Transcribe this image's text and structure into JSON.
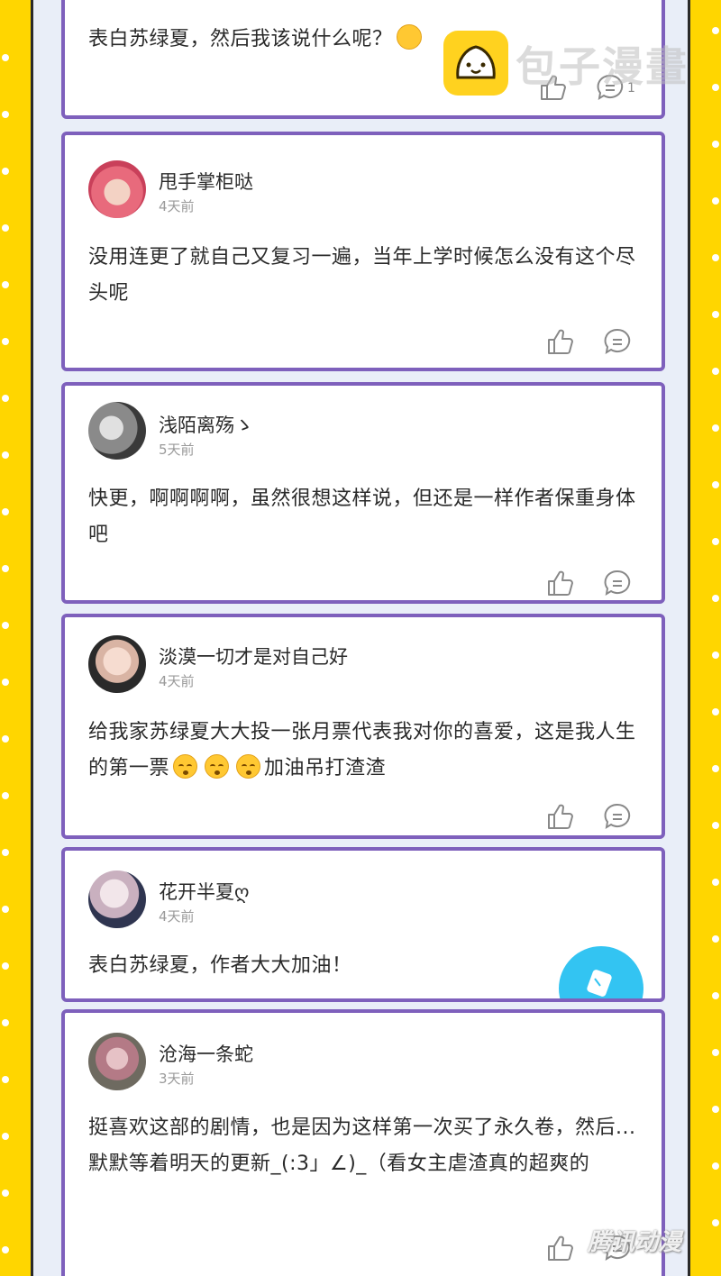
{
  "watermark": {
    "brand_text": "包子漫畫",
    "corner_text": "腾讯动漫"
  },
  "comments": [
    {
      "id": "c0",
      "username": "",
      "time": "",
      "text": "表白苏绿夏，然后我该说什么呢？",
      "reply_count": "1"
    },
    {
      "id": "c1",
      "username": "甩手掌柜哒",
      "time": "4天前",
      "text": "没用连更了就自己又复习一遍，当年上学时候怎么没有这个尽头呢"
    },
    {
      "id": "c2",
      "username": "浅陌离殇ゝ",
      "time": "5天前",
      "text": "快更，啊啊啊啊，虽然很想这样说，但还是一样作者保重身体吧"
    },
    {
      "id": "c3",
      "username": "淡漠一切才是对自己好",
      "time": "4天前",
      "text_part1": "给我家苏绿夏大大投一张月票代表我对你的喜爱，这是我人生的第一票",
      "text_part2": "加油吊打渣渣"
    },
    {
      "id": "c4",
      "username": "花开半夏ღ",
      "time": "4天前",
      "text": "表白苏绿夏，作者大大加油！"
    },
    {
      "id": "c5",
      "username": "沧海一条蛇",
      "time": "3天前",
      "text": "挺喜欢这部的剧情，也是因为这样第一次买了永久卷，然后...默默等着明天的更新_(:3」∠)_（看女主虐渣真的超爽的"
    }
  ],
  "icons": {
    "like": "thumbs-up-icon",
    "reply": "comment-bubble-icon",
    "fab": "edit-icon"
  },
  "colors": {
    "rail": "#FFD600",
    "card_border": "#7E60BC",
    "strip_bg": "#E9EEF8",
    "fab": "#33C4F2"
  }
}
